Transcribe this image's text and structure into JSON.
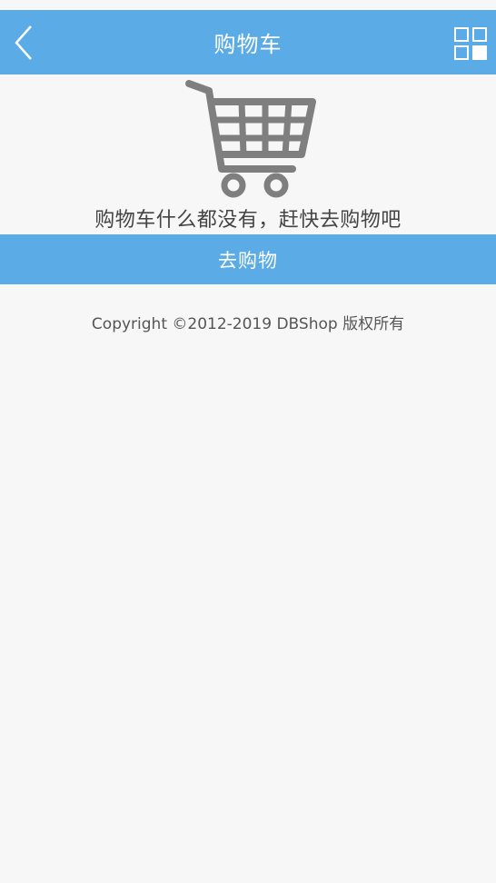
{
  "header": {
    "title": "购物车",
    "back_icon": "chevron-left-icon",
    "menu_icon": "grid-menu-icon"
  },
  "empty_state": {
    "illustration_icon": "shopping-cart-icon",
    "message": "购物车什么都没有，赶快去购物吧"
  },
  "action": {
    "go_shopping_label": "去购物"
  },
  "footer": {
    "copyright": "Copyright ©2012-2019 DBShop 版权所有"
  },
  "colors": {
    "primary": "#5aabe6",
    "background": "#f7f7f7",
    "cart_gray": "#7f7f7f"
  }
}
